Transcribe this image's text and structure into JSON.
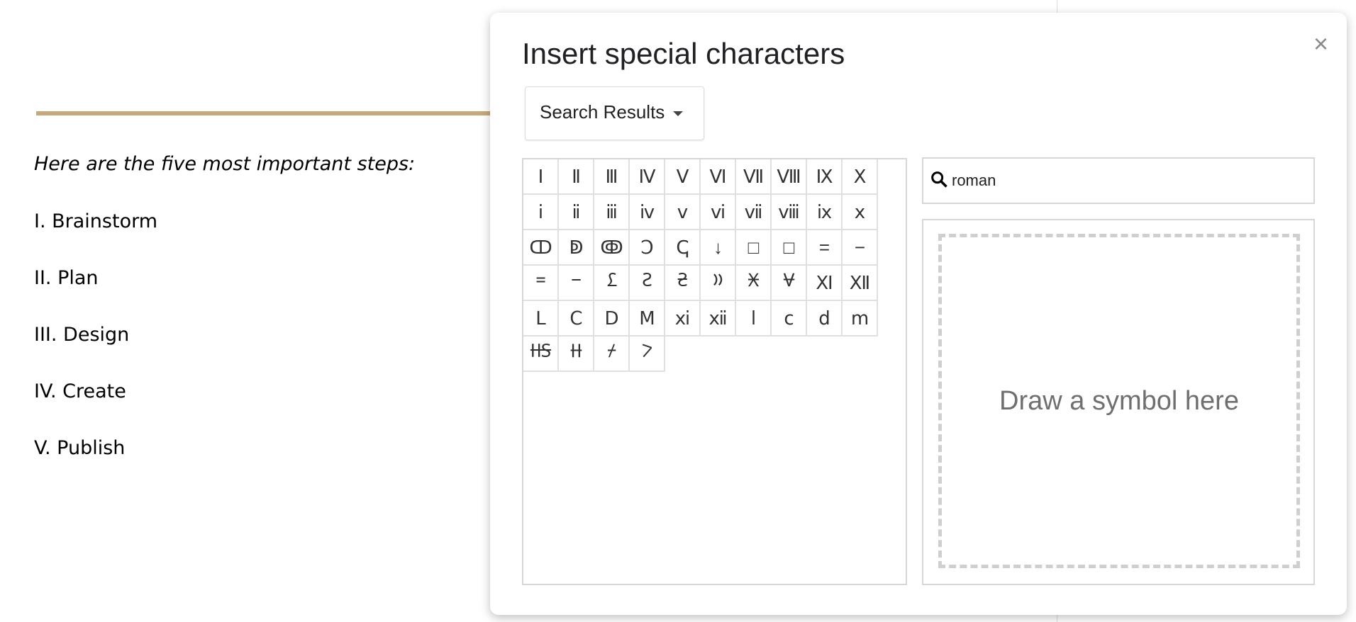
{
  "document": {
    "intro": "Here are the five most important steps:",
    "items": [
      "I. Brainstorm",
      "II. Plan",
      "III. Design",
      "IV. Create",
      "V. Publish"
    ]
  },
  "dialog": {
    "title": "Insert special characters",
    "close_icon": "×",
    "category": "Search Results",
    "search_value": "roman",
    "draw_placeholder": "Draw a symbol here",
    "characters": [
      "Ⅰ",
      "Ⅱ",
      "Ⅲ",
      "Ⅳ",
      "Ⅴ",
      "Ⅵ",
      "Ⅶ",
      "Ⅷ",
      "Ⅸ",
      "Ⅹ",
      "ⅰ",
      "ⅱ",
      "ⅲ",
      "ⅳ",
      "ⅴ",
      "ⅵ",
      "ⅶ",
      "ⅷ",
      "ⅸ",
      "ⅹ",
      "ↀ",
      "ↁ",
      "ↂ",
      "Ↄ",
      "ↅ",
      "↓",
      "□",
      "□",
      "=",
      "−",
      "𐆐",
      "𐆑",
      "𐆒",
      "𐆓",
      "𐆔",
      "𐆕",
      "𐆖",
      "𐆗",
      "Ⅺ",
      "Ⅻ",
      "Ⅼ",
      "Ⅽ",
      "Ⅾ",
      "Ⅿ",
      "ⅺ",
      "ⅻ",
      "ⅼ",
      "ⅽ",
      "ⅾ",
      "ⅿ",
      "𐆘",
      "𐆙",
      "𐆚",
      "𐆛"
    ]
  }
}
